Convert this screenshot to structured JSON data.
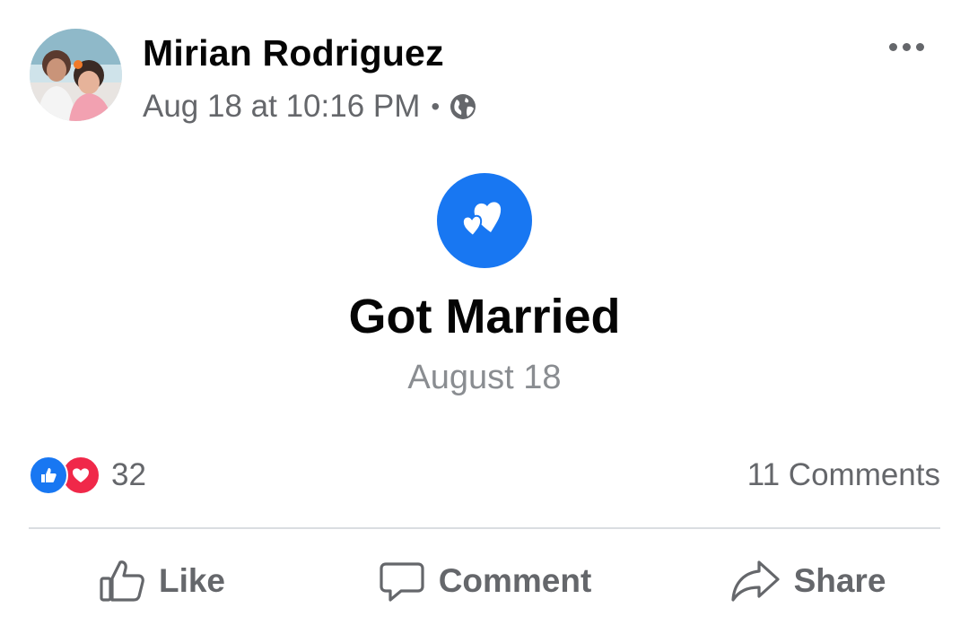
{
  "post": {
    "author": "Mirian Rodriguez",
    "timestamp": "Aug 18 at 10:16 PM",
    "separator": "•",
    "privacy_icon": "globe-icon",
    "more_icon": "more-horizontal-icon"
  },
  "life_event": {
    "icon": "hearts-icon",
    "title": "Got Married",
    "date": "August 18"
  },
  "engagement": {
    "reaction_icons": [
      "like-reaction-icon",
      "love-reaction-icon"
    ],
    "reaction_count": "32",
    "comments_label": "11 Comments"
  },
  "actions": {
    "like_label": "Like",
    "comment_label": "Comment",
    "share_label": "Share"
  },
  "colors": {
    "accent": "#1877f2",
    "love": "#f02849",
    "secondary_text": "#65676b"
  }
}
